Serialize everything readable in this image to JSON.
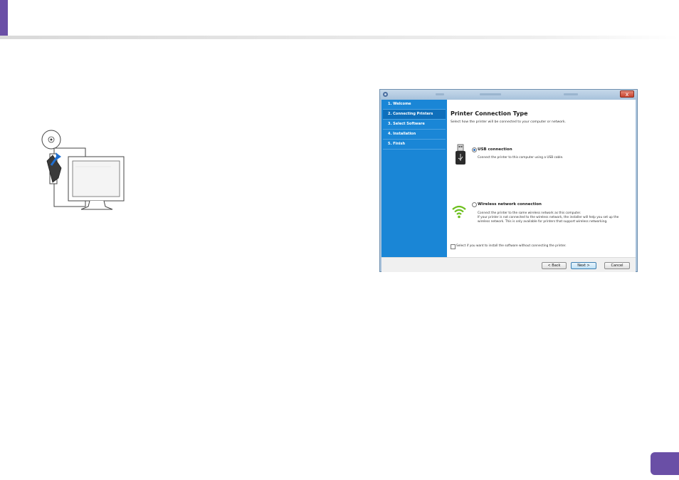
{
  "installer": {
    "steps": [
      {
        "label": "1. Welcome"
      },
      {
        "label": "2. Connecting Printers"
      },
      {
        "label": "3. Select Software"
      },
      {
        "label": "4. Installation"
      },
      {
        "label": "5. Finish"
      }
    ],
    "heading": "Printer Connection Type",
    "instruction": "Select how the printer will be connected to your computer or network.",
    "usb_option": {
      "label": "USB connection",
      "description": "Connect the printer to this computer using a USB cable.",
      "selected": true,
      "icon": "usb-icon"
    },
    "wireless_option": {
      "label": "Wireless network connection",
      "description_lines": [
        "Connect the printer to the same wireless network as this computer.",
        "If your printer is not connected to the wireless network, the installer will help you set up the",
        "wireless network. This is only available for printers that support wireless networking."
      ],
      "selected": false,
      "icon": "wifi-icon"
    },
    "no_connect_checkbox": {
      "label": "Select if you want to install the software without connecting the printer.",
      "checked": false
    },
    "buttons": {
      "back": "< Back",
      "next": "Next >",
      "cancel": "Cancel"
    },
    "close_glyph": "x"
  },
  "colors": {
    "accent": "#6a4fa6",
    "sidebar": "#1a86d6",
    "wifi_green": "#6cbf1c"
  }
}
